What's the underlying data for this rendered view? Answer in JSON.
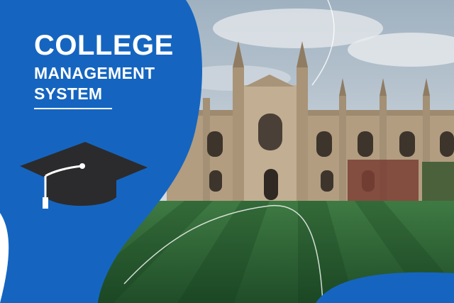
{
  "banner": {
    "title_line1": "COLLEGE",
    "title_line2": "MANAGEMENT",
    "title_line3": "SYSTEM"
  },
  "icons": {
    "cap": "graduation-cap-icon"
  },
  "colors": {
    "panel_blue": "#1565c0",
    "cap_dark": "#2b2b2d",
    "text": "#ffffff",
    "lawn": "#2e6b3a",
    "stone": "#b8a487"
  }
}
